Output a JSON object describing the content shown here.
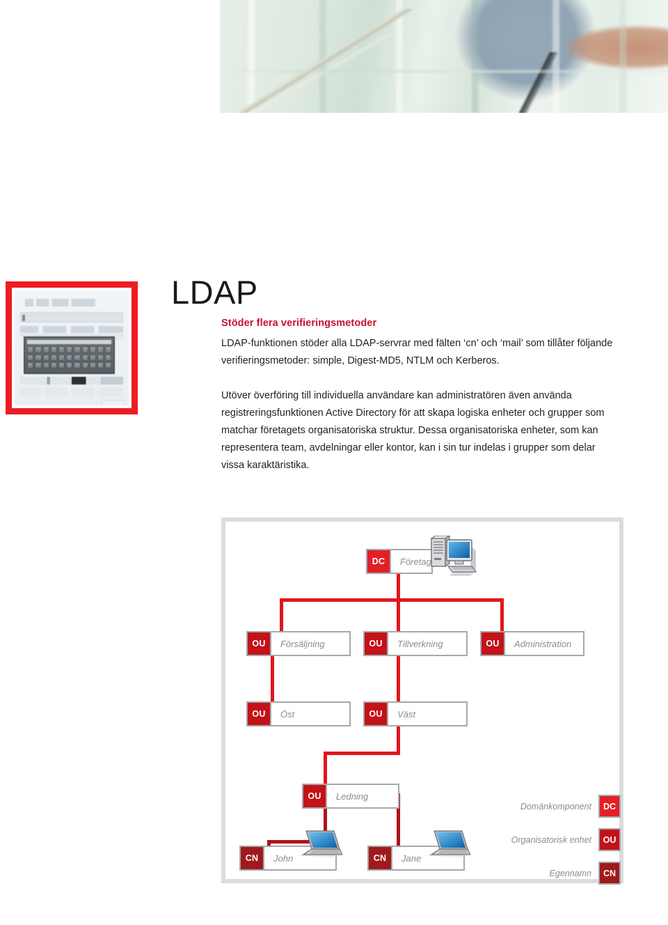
{
  "page": {
    "title": "LDAP",
    "hero_image": "office-glass-partition-photo",
    "thumbnail_image": "device-control-panel-screenshot"
  },
  "content": {
    "lead_heading": "Stöder flera verifieringsmetoder",
    "paragraphs": [
      "LDAP-funktionen stöder alla LDAP-servrar med fälten ‘cn’ och ‘mail’ som tillåter följande verifieringsmetoder: simple, Digest-MD5, NTLM och Kerberos.",
      "Utöver överföring till individuella användare kan administratören även använda registreringsfunktionen Active Directory för att skapa logiska enheter och grupper som matchar företagets organisatoriska struktur. Dessa organisatoriska enheter, som kan representera team, avdelningar eller kontor, kan i sin tur indelas i grupper som delar vissa karaktäristika."
    ]
  },
  "diagram": {
    "nodes": {
      "root": {
        "tag": "DC",
        "label": "Företag",
        "icon": "desktop-computer-icon"
      },
      "sales": {
        "tag": "OU",
        "label": "Försäljning",
        "icon": ""
      },
      "manufacture": {
        "tag": "OU",
        "label": "Tillverkning",
        "icon": ""
      },
      "admin": {
        "tag": "OU",
        "label": "Administration",
        "icon": ""
      },
      "east": {
        "tag": "OU",
        "label": "Öst",
        "icon": ""
      },
      "west": {
        "tag": "OU",
        "label": "Väst",
        "icon": ""
      },
      "management": {
        "tag": "OU",
        "label": "Ledning",
        "icon": ""
      },
      "john": {
        "tag": "CN",
        "label": "John",
        "icon": "laptop-icon"
      },
      "jane": {
        "tag": "CN",
        "label": "Jane",
        "icon": "laptop-icon"
      }
    },
    "legend": [
      {
        "text": "Domänkomponent",
        "tag": "DC"
      },
      {
        "text": "Organisatorisk enhet",
        "tag": "OU"
      },
      {
        "text": "Egennamn",
        "tag": "CN"
      }
    ]
  },
  "colors": {
    "accent_red": "#c8102e",
    "tag_dc": "#e31f26",
    "tag_ou": "#c41219",
    "tag_cn": "#9e1a1c",
    "connector": "#e2161d",
    "frame_gray": "#dcdcdc",
    "label_gray": "#8c8c8c"
  }
}
